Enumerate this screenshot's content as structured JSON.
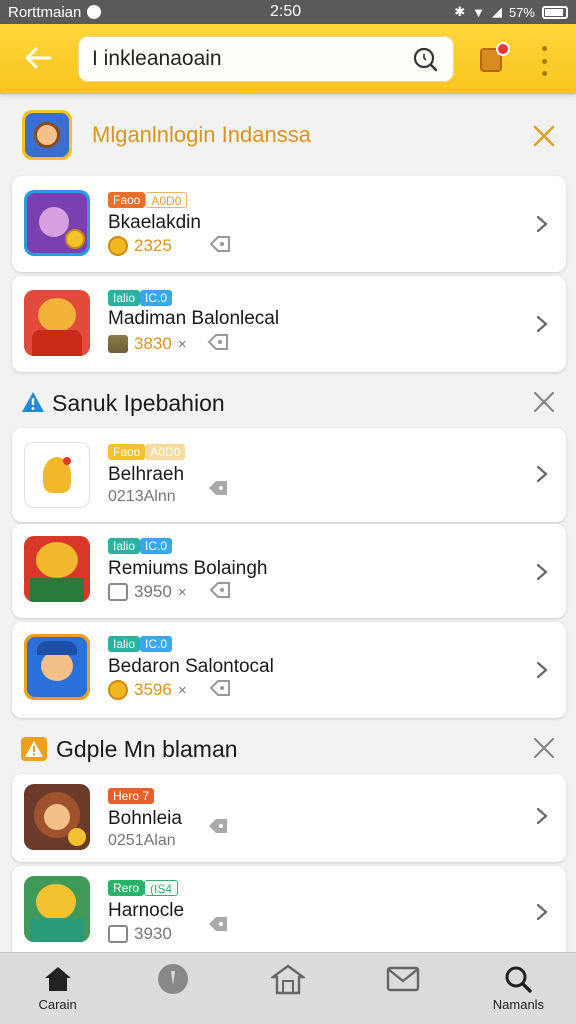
{
  "status_bar": {
    "carrier": "Rorttmaian",
    "time": "2:50",
    "battery": "57%"
  },
  "search": {
    "value": "I inkleanaoain"
  },
  "promo": {
    "title": "Mlganlnlogin Indanssa"
  },
  "sections": [
    {
      "title": "Mlganlnlogin Indanssa",
      "items": [
        {
          "tag1": "Faoo",
          "tag2": "A0D0",
          "name": "Bkaelakdin",
          "meta": "2325",
          "meta_icon": "coin",
          "thumb_bg": "#7a3fb0",
          "tag1_color": "#e8702a",
          "tag2_color": "#f4b55a"
        },
        {
          "tag1": "Ialio",
          "tag2": "IC.0",
          "name": "Madiman Balonlecal",
          "meta": "3830",
          "meta_icon": "stack",
          "thumb_bg": "#e24b3b",
          "tag1_color": "#2ab1a0",
          "tag2_color": "#3aa7e8"
        }
      ]
    },
    {
      "title": "Sanuk Ipebahion",
      "items": [
        {
          "tag1": "Faoo",
          "tag2": "A0D0",
          "name": "Belhraeh",
          "meta": "0213Alnn",
          "meta_icon": "none",
          "thumb_bg": "#ffffff",
          "tag1_color": "#f2c230",
          "tag2_color": "#f4c46a"
        },
        {
          "tag1": "Ialio",
          "tag2": "IC.0",
          "name": "Remiums Bolaingh",
          "meta": "3950",
          "meta_icon": "gray",
          "thumb_bg": "#d9372a",
          "tag1_color": "#2ab1a0",
          "tag2_color": "#3aa7e8"
        },
        {
          "tag1": "Ialio",
          "tag2": "IC.0",
          "name": "Bedaron Salontocal",
          "meta": "3596",
          "meta_icon": "coin",
          "thumb_bg": "#2b6fd9",
          "tag1_color": "#2ab1a0",
          "tag2_color": "#3aa7e8"
        }
      ]
    },
    {
      "title": "Gdple Mn blaman",
      "items": [
        {
          "tag1": "Hero 7",
          "tag2": "",
          "name": "Bohnleia",
          "meta": "0251Alan",
          "meta_icon": "none",
          "thumb_bg": "#6b3a2a",
          "tag1_color": "#e8602a",
          "tag2_color": ""
        },
        {
          "tag1": "Rero",
          "tag2": "(IS4",
          "name": "Harnocle",
          "meta": "3930",
          "meta_icon": "gray",
          "thumb_bg": "#3f9a5a",
          "tag1_color": "#2ab16a",
          "tag2_color": "#2ab16a"
        }
      ]
    }
  ],
  "bottom_nav": [
    {
      "label": "Carain",
      "icon": "home-icon"
    },
    {
      "label": "",
      "icon": "info-icon"
    },
    {
      "label": "",
      "icon": "store-icon"
    },
    {
      "label": "",
      "icon": "mail-icon"
    },
    {
      "label": "Namanls",
      "icon": "search-icon"
    }
  ],
  "colors": {
    "appbar": "#ffd63a",
    "accent": "#f0a020"
  }
}
